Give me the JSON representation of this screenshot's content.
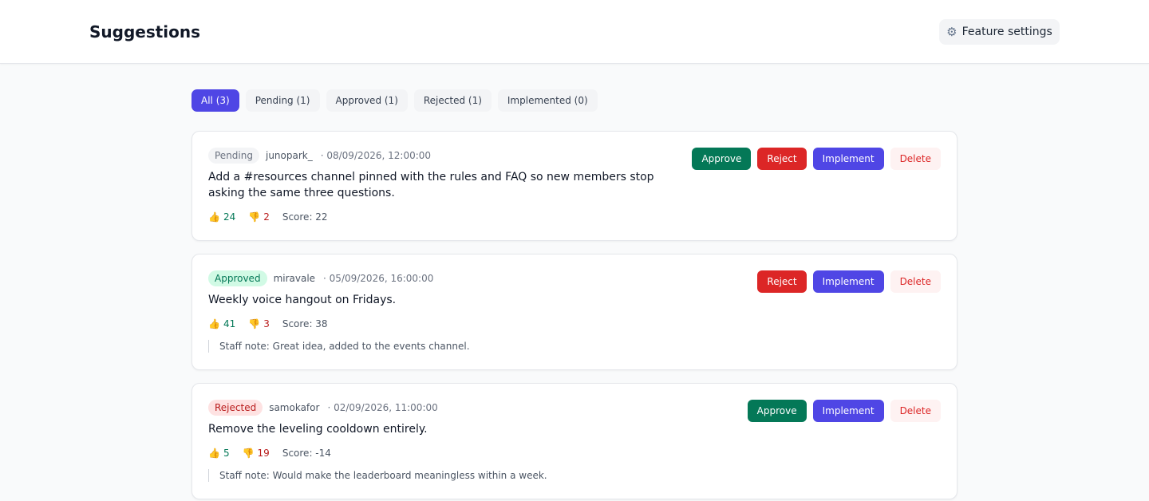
{
  "header": {
    "title": "Suggestions",
    "settings_label": "Feature settings"
  },
  "tabs": [
    {
      "label": "All (3)",
      "active": true
    },
    {
      "label": "Pending (1)",
      "active": false
    },
    {
      "label": "Approved (1)",
      "active": false
    },
    {
      "label": "Rejected (1)",
      "active": false
    },
    {
      "label": "Implemented (0)",
      "active": false
    }
  ],
  "colors": {
    "accent": "#4f46e5",
    "approve": "#047857",
    "reject": "#dc2626",
    "delete_bg": "#fef2f2"
  },
  "suggestions": [
    {
      "status": "Pending",
      "author": "junopark_",
      "time": "· 08/09/2026, 12:00:00",
      "text": "Add a #resources channel pinned with the rules and FAQ so new members stop asking the same three questions.",
      "upvotes": "24",
      "downvotes": "2",
      "score": "Score: 22",
      "actions": {
        "approve": "Approve",
        "reject": "Reject",
        "implement": "Implement",
        "delete": "Delete"
      }
    },
    {
      "status": "Approved",
      "author": "miravale",
      "time": "· 05/09/2026, 16:00:00",
      "text": "Weekly voice hangout on Fridays.",
      "upvotes": "41",
      "downvotes": "3",
      "score": "Score: 38",
      "staff_note": "Staff note: Great idea, added to the events channel.",
      "actions": {
        "reject": "Reject",
        "implement": "Implement",
        "delete": "Delete"
      }
    },
    {
      "status": "Rejected",
      "author": "samokafor",
      "time": "· 02/09/2026, 11:00:00",
      "text": "Remove the leveling cooldown entirely.",
      "upvotes": "5",
      "downvotes": "19",
      "score": "Score: -14",
      "staff_note": "Staff note: Would make the leaderboard meaningless within a week.",
      "actions": {
        "approve": "Approve",
        "implement": "Implement",
        "delete": "Delete"
      }
    }
  ]
}
